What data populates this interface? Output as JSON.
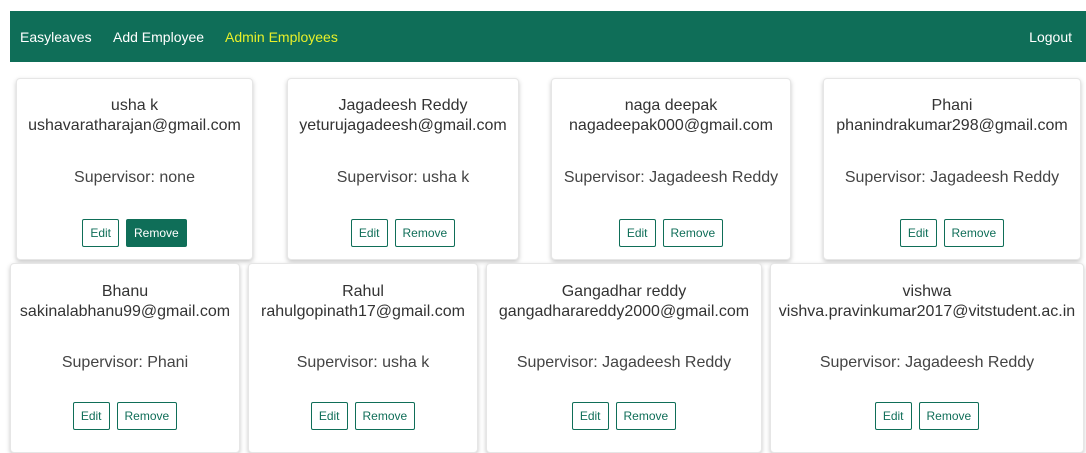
{
  "nav": {
    "brand": "Easyleaves",
    "add": "Add Employee",
    "admin": "Admin Employees",
    "logout": "Logout"
  },
  "colors": {
    "primary": "#0f6e58",
    "active_link": "#e8f02a"
  },
  "employees": [
    {
      "name": "usha k",
      "email": "ushavaratharajan@gmail.com",
      "supervisor": "Supervisor: none",
      "edit": "Edit",
      "remove": "Remove"
    },
    {
      "name": "Jagadeesh Reddy",
      "email": "yeturujagadeesh@gmail.com",
      "supervisor": "Supervisor: usha k",
      "edit": "Edit",
      "remove": "Remove"
    },
    {
      "name": "naga deepak",
      "email": "nagadeepak000@gmail.com",
      "supervisor": "Supervisor: Jagadeesh Reddy",
      "edit": "Edit",
      "remove": "Remove"
    },
    {
      "name": "Phani",
      "email": "phanindrakumar298@gmail.com",
      "supervisor": "Supervisor: Jagadeesh Reddy",
      "edit": "Edit",
      "remove": "Remove"
    },
    {
      "name": "Bhanu",
      "email": "sakinalabhanu99@gmail.com",
      "supervisor": "Supervisor: Phani",
      "edit": "Edit",
      "remove": "Remove"
    },
    {
      "name": "Rahul",
      "email": "rahulgopinath17@gmail.com",
      "supervisor": "Supervisor: usha k",
      "edit": "Edit",
      "remove": "Remove"
    },
    {
      "name": "Gangadhar reddy",
      "email": "gangadharareddy2000@gmail.com",
      "supervisor": "Supervisor: Jagadeesh Reddy",
      "edit": "Edit",
      "remove": "Remove"
    },
    {
      "name": "vishwa",
      "email": "vishva.pravinkumar2017@vitstudent.ac.in",
      "supervisor": "Supervisor: Jagadeesh Reddy",
      "edit": "Edit",
      "remove": "Remove"
    }
  ]
}
